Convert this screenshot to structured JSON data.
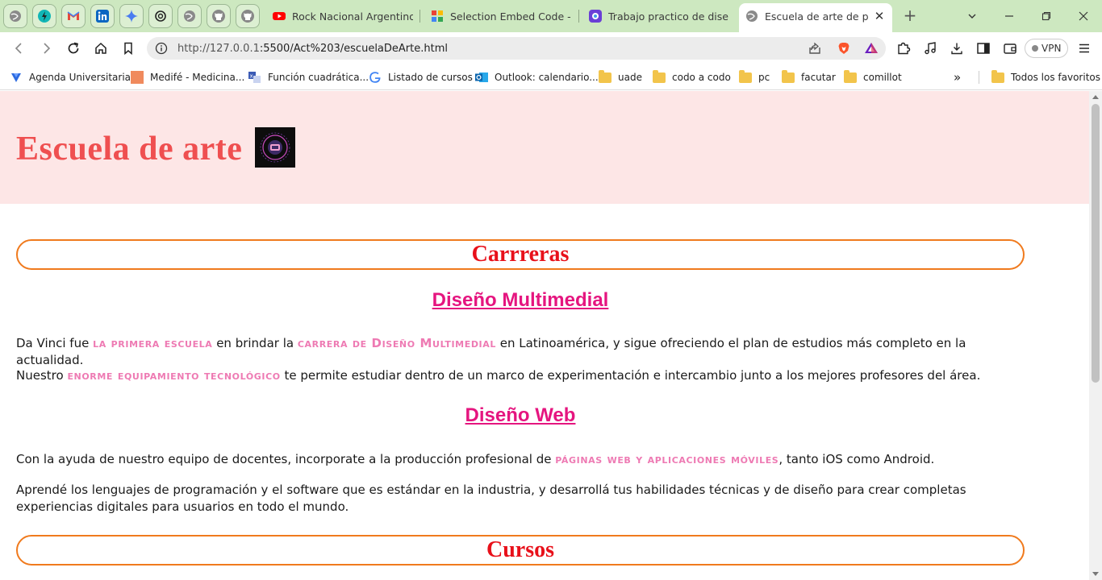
{
  "browser": {
    "pinned_tabs": [
      "globe-icon",
      "bolt-icon",
      "gmail-icon",
      "linkedin-icon",
      "gemini-icon",
      "chatgpt-icon",
      "globe-icon",
      "github-icon",
      "github-icon"
    ],
    "tabs": [
      {
        "title": "Rock Nacional Argentino - D",
        "icon": "youtube-icon"
      },
      {
        "title": "Selection Embed Code - Goo",
        "icon": "google-icon"
      },
      {
        "title": "Trabajo practico de diseño y",
        "icon": "app-icon"
      },
      {
        "title": "Escuela de arte de progr",
        "icon": "globe-icon",
        "active": true
      }
    ],
    "new_tab": "+",
    "url_host": "http://127.0.0.1",
    "url_rest": ":5500/Act%203/escuelaDeArte.html",
    "vpn_label": "VPN"
  },
  "bookmarks": [
    {
      "label": "Agenda Universitaria",
      "icon": "bookmark-blue-icon"
    },
    {
      "label": "Medifé - Medicina...",
      "icon": "medife-icon"
    },
    {
      "label": "Función cuadrática...",
      "icon": "translate-icon"
    },
    {
      "label": "Listado de cursos",
      "icon": "google-icon"
    },
    {
      "label": "Outlook: calendario...",
      "icon": "outlook-icon"
    },
    {
      "label": "uade",
      "icon": "folder-icon"
    },
    {
      "label": "codo a codo",
      "icon": "folder-icon"
    },
    {
      "label": "pc",
      "icon": "folder-icon"
    },
    {
      "label": "facutar",
      "icon": "folder-icon"
    },
    {
      "label": "comillot",
      "icon": "folder-icon"
    }
  ],
  "all_bookmarks": "Todos los favoritos",
  "page": {
    "title": "Escuela de arte",
    "section1": "Carrreras",
    "sub1": "Diseño Multimedial",
    "p1": {
      "a": "Da Vinci fue ",
      "b": "la primera escuela",
      "c": " en brindar la ",
      "d": "carrera de Diseño Multimedial",
      "e": " en Latinoamérica, y sigue ofreciendo el plan de estudios más completo en la actualidad."
    },
    "p2": {
      "a": "Nuestro ",
      "b": "enorme equipamiento tecnológico",
      "c": " te permite estudiar dentro de un marco de experimentación e intercambio junto a los mejores profesores del área."
    },
    "sub2": "Diseño Web",
    "p3": {
      "a": "Con la ayuda de nuestro equipo de docentes, incorporate a la producción profesional de ",
      "b": "páginas web y aplicaciones móviles",
      "c": ", tanto iOS como Android."
    },
    "p4": "Aprendé los lenguajes de programación y el software que es estándar en la industria, y desarrollá tus habilidades técnicas y de diseño para crear completas experiencias digitales para usuarios en todo el mundo.",
    "section2": "Cursos"
  },
  "colors": {
    "tabstrip": "#cde8c0",
    "header_bg": "#fde6e6",
    "title": "#ef4f50",
    "section_border": "#f07a1d",
    "section_text": "#e8101a",
    "subtitle": "#e5157f",
    "highlight": "#ee7ab3"
  }
}
